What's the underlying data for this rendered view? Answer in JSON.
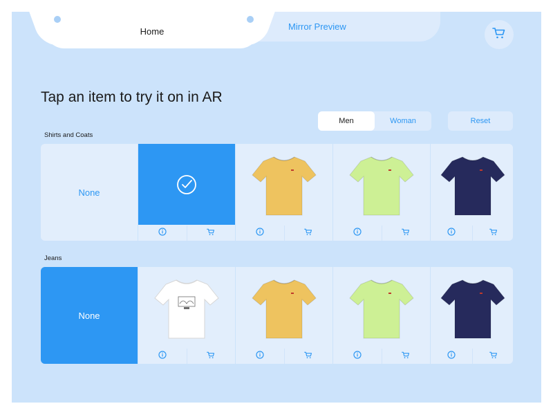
{
  "tabs": {
    "home_label": "Home",
    "mirror_label": "Mirror Preview"
  },
  "header": {
    "cart_icon": "cart-icon"
  },
  "heading": "Tap an item to try it on in AR",
  "gender_filter": {
    "men_label": "Men",
    "woman_label": "Woman",
    "selected": "Men"
  },
  "reset_label": "Reset",
  "sections": [
    {
      "title": "Shirts and Coats",
      "none_label": "None",
      "items": [
        {
          "shirt_color": "#2d97f3",
          "selected": true
        },
        {
          "shirt_color": "#eec35f"
        },
        {
          "shirt_color": "#cdf095"
        },
        {
          "shirt_color": "#262a5c"
        }
      ]
    },
    {
      "title": "Jeans",
      "none_label": "None",
      "items": [
        {
          "shirt_color": "#ffffff"
        },
        {
          "shirt_color": "#eec35f"
        },
        {
          "shirt_color": "#cdf095"
        },
        {
          "shirt_color": "#262a5c"
        }
      ]
    }
  ],
  "colors": {
    "accent": "#2d97f3",
    "background": "#cce3fb",
    "tab_inactive": "#ddebfc"
  }
}
